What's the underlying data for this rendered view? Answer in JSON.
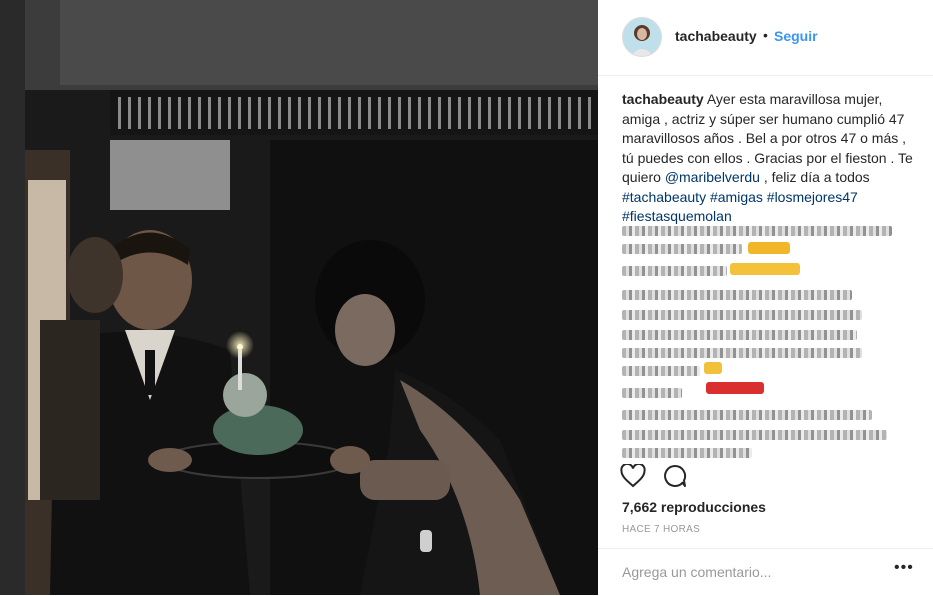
{
  "post": {
    "username": "tachabeauty",
    "separator": "•",
    "follow_label": "Seguir",
    "caption": {
      "username": "tachabeauty",
      "text_1": " Ayer esta maravillosa mujer, amiga , actriz y súper ser humano cumplió 47 maravillosos años . Bel a por otros 47 o más , tú puedes con ellos . Gracias por el fieston . Te quiero ",
      "mention": "@maribelverdu",
      "text_2": " , feliz día a todos ",
      "hashtags": [
        "#tachabeauty",
        "#amigas",
        "#losmejores47",
        "#fiestasquemolan"
      ]
    },
    "views": "7,662 reproducciones",
    "time_ago": "HACE 7 HORAS",
    "comment_placeholder": "Agrega un comentario...",
    "more_label": "•••"
  },
  "colors": {
    "link": "#3897f0",
    "hashtag": "#003569",
    "text": "#262626",
    "muted": "#999999"
  },
  "icons": [
    "heart-icon",
    "comment-icon",
    "more-options-icon"
  ]
}
